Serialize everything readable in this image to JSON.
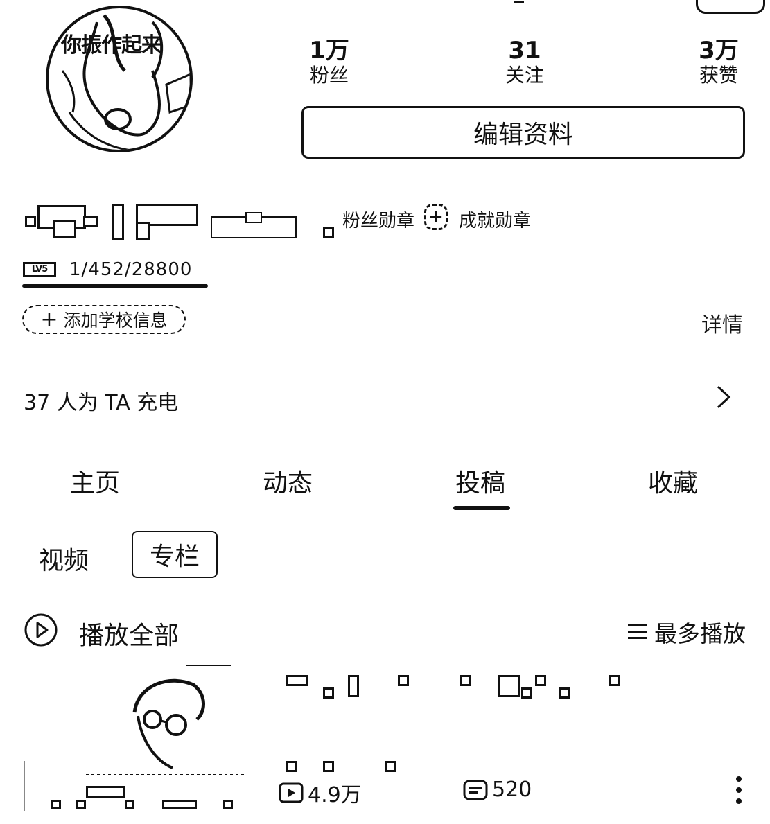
{
  "avatar": {
    "overlay_text": "你振作起来"
  },
  "stats": [
    {
      "value": "1万",
      "label": "粉丝"
    },
    {
      "value": "31",
      "label": "关注"
    },
    {
      "value": "3万",
      "label": "获赞"
    }
  ],
  "edit_profile_label": "编辑资料",
  "badges": {
    "fan_badge": "粉丝勋章",
    "achievement_badge": "成就勋章"
  },
  "level": {
    "icon_text": "LV5",
    "exp": "1/452/28800"
  },
  "school_button": "添加学校信息",
  "details_link": "详情",
  "charge_text": "37 人为 TA 充电",
  "tabs": [
    {
      "label": "主页",
      "active": false
    },
    {
      "label": "动态",
      "active": false
    },
    {
      "label": "投稿",
      "active": true
    },
    {
      "label": "收藏",
      "active": false
    }
  ],
  "subtabs": {
    "video": "视频",
    "column": "专栏"
  },
  "play_all": "播放全部",
  "sort": "最多播放",
  "video": {
    "views": "4.9万",
    "comments": "520"
  }
}
